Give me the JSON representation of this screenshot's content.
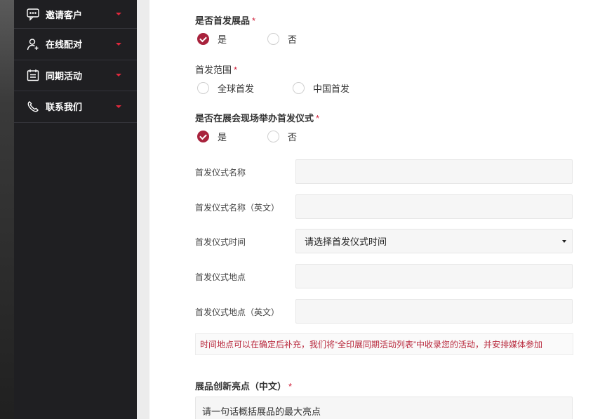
{
  "sidebar": {
    "items": [
      {
        "label": "邀请客户",
        "icon": "chat-bubble-icon"
      },
      {
        "label": "在线配对",
        "icon": "user-add-icon"
      },
      {
        "label": "同期活动",
        "icon": "calendar-icon"
      },
      {
        "label": "联系我们",
        "icon": "phone-icon"
      }
    ]
  },
  "form": {
    "first_exhibit": {
      "label": "是否首发展品",
      "required": "*",
      "options": [
        "是",
        "否"
      ],
      "selected": "是"
    },
    "launch_scope": {
      "label": "首发范围",
      "required": "*",
      "options": [
        "全球首发",
        "中国首发"
      ],
      "selected": ""
    },
    "ceremony_onsite": {
      "label": "是否在展会现场举办首发仪式",
      "required": "*",
      "options": [
        "是",
        "否"
      ],
      "selected": "是"
    },
    "fields": {
      "ceremony_name": {
        "label": "首发仪式名称",
        "value": ""
      },
      "ceremony_name_en": {
        "label": "首发仪式名称（英文）",
        "value": ""
      },
      "ceremony_time": {
        "label": "首发仪式时间",
        "value": "请选择首发仪式时间"
      },
      "ceremony_place": {
        "label": "首发仪式地点",
        "value": ""
      },
      "ceremony_place_en": {
        "label": "首发仪式地点（英文）",
        "value": ""
      }
    },
    "notice": "时间地点可以在确定后补充，我们将“全印展同期活动列表”中收录您的活动，并安排媒体参加",
    "highlight": {
      "label": "展品创新亮点（中文）",
      "required": "*",
      "placeholder": "请一句话概括展品的最大亮点"
    }
  },
  "colors": {
    "accent": "#a8223c",
    "required": "#d0203a",
    "sidebar_bg": "#1f1f22",
    "caret": "#e0283c"
  }
}
